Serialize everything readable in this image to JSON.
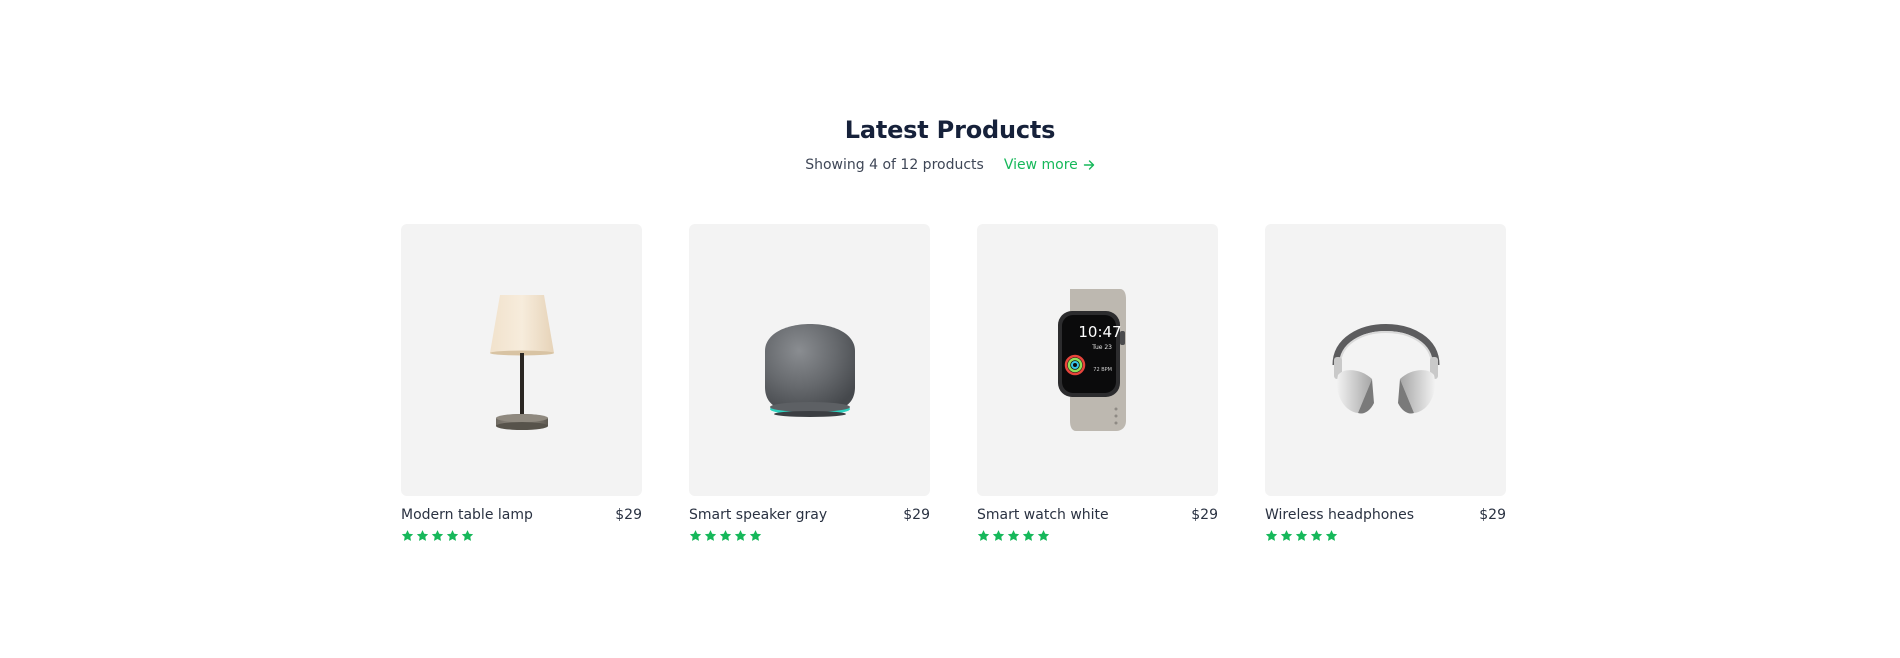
{
  "section": {
    "title": "Latest Products",
    "showing_text": "Showing 4 of 12 products",
    "view_more_label": "View more"
  },
  "products": [
    {
      "name": "Modern table lamp",
      "price": "$29",
      "rating": 5,
      "image_icon": "table-lamp-image"
    },
    {
      "name": "Smart speaker gray",
      "price": "$29",
      "rating": 5,
      "image_icon": "smart-speaker-image"
    },
    {
      "name": "Smart watch white",
      "price": "$29",
      "rating": 5,
      "image_icon": "smart-watch-image"
    },
    {
      "name": "Wireless headphones",
      "price": "$29",
      "rating": 5,
      "image_icon": "headphones-image"
    }
  ],
  "watch_face": {
    "time": "10:47",
    "date": "Tue 23",
    "bpm": "72 BPM"
  },
  "colors": {
    "accent": "#16b85a",
    "title": "#16213a",
    "card_bg": "#f3f3f3",
    "star": "#16b85a"
  }
}
